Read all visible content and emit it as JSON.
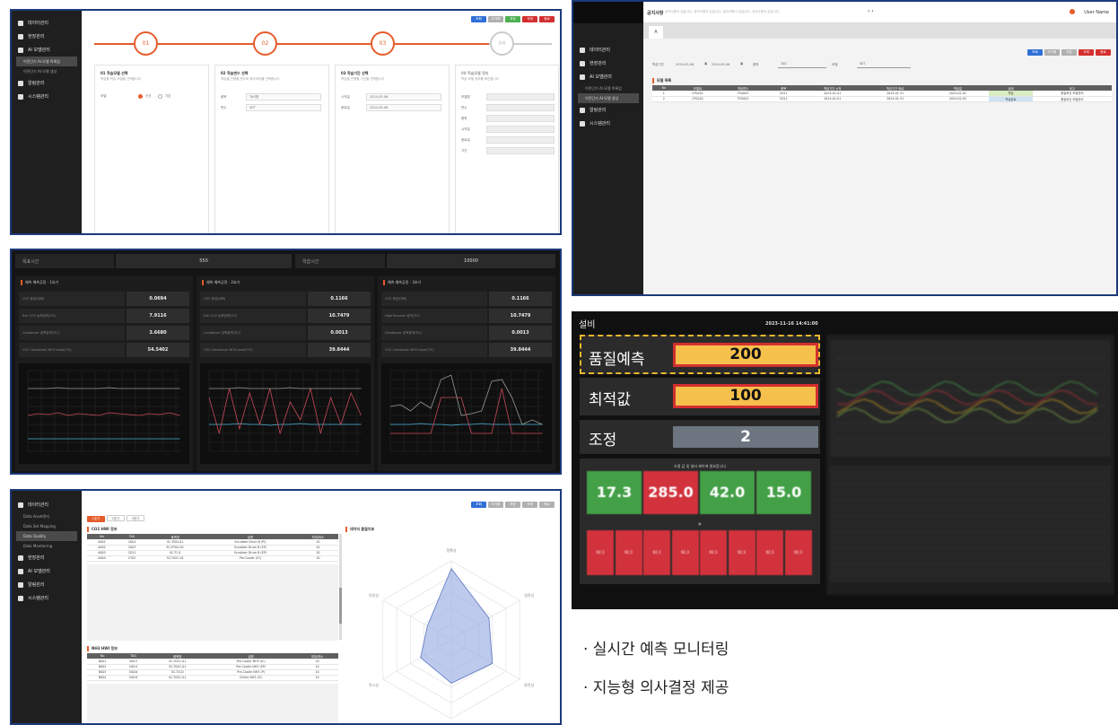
{
  "sidebar": {
    "items": [
      "데이터관리",
      "현장관리",
      "AI 모델관리",
      "알림관리",
      "시스템관리"
    ],
    "ai_sub": [
      "이전단기 AI 모델 목록업",
      "이전단기 AI 모델 생성"
    ],
    "data_sub": [
      "Data Asset관리",
      "Data Set Mapping",
      "Data Quality",
      "Data Monitoring"
    ]
  },
  "panel1": {
    "buttons": [
      "조회",
      "초기화",
      "저장",
      "삭제",
      "종료"
    ],
    "steps": [
      "01",
      "02",
      "03",
      "04"
    ],
    "cards": [
      {
        "title": "01 학습모델 선택",
        "sub": "학습할 학습 모델을 선택합니다",
        "opt1": "신규",
        "opt2": "기존"
      },
      {
        "title": "02 학습변수 선택",
        "sub": "학습을 진행할 변수와 파라미터를 선택합니다",
        "l1": "품목",
        "v1": "TAG명",
        "l2": "변수",
        "v2": "SET"
      },
      {
        "title": "03 학습기간 선택",
        "sub": "학습을 진행할 기간을 선택합니다",
        "l1": "시작일",
        "v1": "2024-05-06",
        "l2": "종료일",
        "v2": "2024-05-06"
      },
      {
        "title": "04 학습모델 정리",
        "sub": "학습 모델 정보를 확인합니다",
        "rows": [
          "모델명",
          "변수",
          "품목",
          "시작일",
          "종료일",
          "기간"
        ]
      }
    ]
  },
  "panel2": {
    "title": "공지사항",
    "notice": "공지사항이 있습니다. 공지사항이 있습니다. 공지사항이 있습니다. 공지사항이 있습니다.",
    "user": "User Name",
    "tab": "A",
    "buttons": [
      "조회",
      "초기화",
      "저장",
      "삭제",
      "종료"
    ],
    "filter_labels": [
      "학습기간",
      "품목",
      "모델"
    ],
    "filter_values": [
      "2024-05-06",
      "2024-05-06",
      "TAG",
      "SET"
    ],
    "section": "모델 목록",
    "columns": [
      "No",
      "모델ID",
      "학습변수",
      "품목",
      "학습기간 시작",
      "학습기간 종료",
      "학습일",
      "상태",
      "비고"
    ],
    "rows": [
      [
        "1",
        "CP0201",
        "TEG001",
        "CD11",
        "2024-01-01",
        "2024-01-31",
        "2024-02-02",
        "학습",
        "품질최신 모델관리"
      ],
      [
        "2",
        "CP0201",
        "TEG001",
        "CD11",
        "2024-01-01",
        "2024-01-31",
        "2024-02-05",
        "학습완료",
        "품질최신 모델관리"
      ]
    ]
  },
  "panel3": {
    "top": [
      {
        "label": "목표시간",
        "value": "550"
      },
      {
        "label": "학습시간",
        "value": "10000"
      }
    ],
    "groups": [
      {
        "title": "예측 예측공정 - 1호기",
        "rows": [
          [
            "CO2 총압(대략)",
            "0.0694"
          ],
          [
            "Exh CO2 농축압력(TIC)",
            "7.9116"
          ],
          [
            "Condenser 압축압력(TIC)",
            "3.6680"
          ],
          [
            "CO2 Condenser NH3 Level(TIC)",
            "54.5402"
          ]
        ]
      },
      {
        "title": "예측 예측공정 - 2호기",
        "rows": [
          [
            "CO2 총압(대략)",
            "0.1166"
          ],
          [
            "Exh CO2 농축압력(TIC)",
            "10.7479"
          ],
          [
            "Condenser 압축압력(TIC)",
            "0.0013"
          ],
          [
            "CO2 Condenser NH3 Level(TIC)",
            "39.8444"
          ]
        ]
      },
      {
        "title": "예측 예측공정 - 3호기",
        "rows": [
          [
            "CO2 총압(대략)",
            "0.1166"
          ],
          [
            "High Recover 압력(TIC)",
            "10.7479"
          ],
          [
            "Condenser 압축압력(TIC)",
            "0.0013"
          ],
          [
            "CO2 Condenser NH3 Level(TIC)",
            "39.8444"
          ]
        ]
      }
    ]
  },
  "panel4": {
    "title": "설비",
    "datetime": "2023-11-16 14:41:00",
    "metrics": [
      {
        "label": "품질예측",
        "value": "200"
      },
      {
        "label": "최적값",
        "value": "100"
      },
      {
        "label": "조정",
        "value": "2"
      }
    ],
    "caption": "조절 값 및 설비 제어에 필요합니다",
    "greens": [
      "17.3",
      "285.0",
      "42.0",
      "15.0"
    ],
    "reds": [
      "92.3",
      "92.3",
      "92.3",
      "92.3",
      "92.3",
      "92.3",
      "92.3",
      "92.3"
    ]
  },
  "panel5": {
    "buttons": [
      "조회",
      "초기화",
      "저장",
      "삭제",
      "종료"
    ],
    "tabs": [
      "1호기",
      "2호기",
      "3호기"
    ],
    "section1": "CO2 HWI 정보",
    "section2": "NH3 HWI 정보",
    "radar_title": "데이터 품질지표",
    "columns": [
      "No",
      "TAG",
      "품목명",
      "설명",
      "최대/최소"
    ],
    "rows1": [
      [
        "A001",
        "CD01",
        "SC-TI0G-01",
        "Scrubber Drum B (PI)",
        "10"
      ],
      [
        "A002",
        "CD07",
        "SC-PT0G-01",
        "Scrubber Drum B (EP)",
        "10"
      ],
      [
        "A003",
        "CD11",
        "SC-TI-G",
        "Scrubber Drum B (EP)",
        "10"
      ],
      [
        "A004",
        "CT02",
        "SC-T02C-01",
        "Pre-Cooler (IO)",
        "10"
      ]
    ],
    "rows2": [
      [
        "B001",
        "N013",
        "SC-T01C-01",
        "Pre-Cooler NH3 (IC)",
        "10"
      ],
      [
        "B002",
        "N014",
        "SC-T04C-01",
        "Pre-Cooler NH3 (EP)",
        "10"
      ],
      [
        "B003",
        "N016",
        "SC-T1C0",
        "Pre-Cooler NH3 (P)",
        "10"
      ],
      [
        "B004",
        "N019",
        "SC-T05C-01",
        "Chiller NH3 (IC)",
        "10"
      ]
    ],
    "radar_axes": [
      "정확성",
      "일관성",
      "완전성",
      "유효성",
      "적시성",
      "유일성"
    ],
    "radar_values": [
      0.9,
      0.55,
      0.6,
      0.55,
      0.45,
      0.35
    ]
  },
  "bullets": [
    "· 실시간 예측 모니터링",
    "· 지능형 의사결정 제공"
  ]
}
